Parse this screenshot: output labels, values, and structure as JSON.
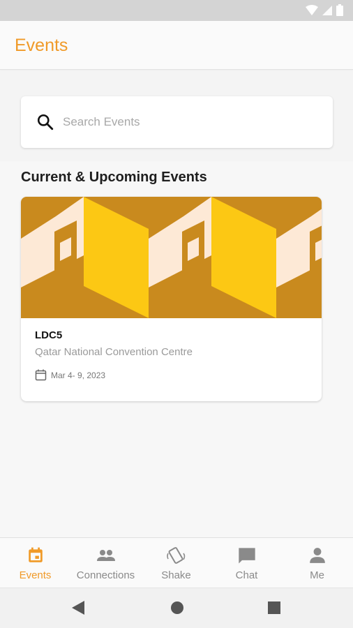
{
  "app": {
    "title": "Events"
  },
  "search": {
    "placeholder": "Search Events"
  },
  "section": {
    "title": "Current & Upcoming Events"
  },
  "events": [
    {
      "name": "LDC5",
      "venue": "Qatar National Convention Centre",
      "date": "Mar  4- 9, 2023"
    }
  ],
  "bottom_nav": [
    {
      "label": "Events",
      "icon": "calendar-icon",
      "active": true
    },
    {
      "label": "Connections",
      "icon": "people-icon",
      "active": false
    },
    {
      "label": "Shake",
      "icon": "shake-phone-icon",
      "active": false
    },
    {
      "label": "Chat",
      "icon": "chat-icon",
      "active": false
    },
    {
      "label": "Me",
      "icon": "person-icon",
      "active": false
    }
  ],
  "colors": {
    "accent": "#f09a28",
    "banner_gold": "#c98a1e",
    "banner_yellow": "#fcc814",
    "banner_cream": "#fde9d6",
    "inactive": "#8a8a8a"
  }
}
